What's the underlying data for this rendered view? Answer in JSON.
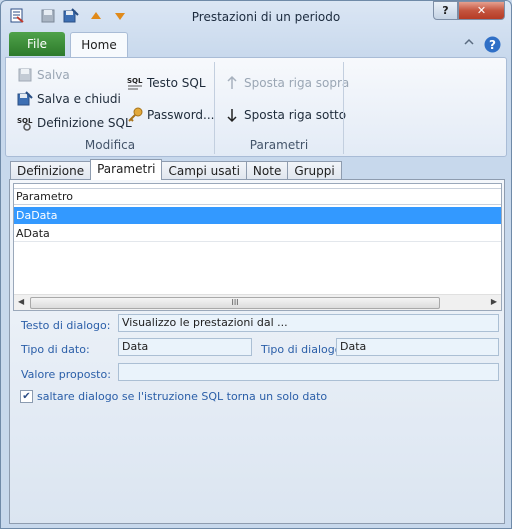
{
  "window": {
    "title": "Prestazioni di un periodo",
    "help_glyph": "?",
    "close_glyph": "✕"
  },
  "ribbon": {
    "tabs": {
      "file": "File",
      "home": "Home"
    },
    "modifica": {
      "salva": "Salva",
      "salva_chiudi": "Salva e chiudi",
      "definizione_sql": "Definizione SQL",
      "testo_sql": "Testo SQL",
      "password": "Password...",
      "label": "Modifica"
    },
    "parametri": {
      "sposta_sopra": "Sposta riga sopra",
      "sposta_sotto": "Sposta riga sotto",
      "label": "Parametri"
    }
  },
  "tabs": [
    "Definizione",
    "Parametri",
    "Campi usati",
    "Note",
    "Gruppi"
  ],
  "grid": {
    "header": "Parametro",
    "rows": [
      "DaData",
      "AData"
    ],
    "scroll_glyph": "III"
  },
  "form": {
    "testo_dialogo_label": "Testo di dialogo:",
    "testo_dialogo_value": "Visualizzo le prestazioni dal ...",
    "tipo_dato_label": "Tipo di dato:",
    "tipo_dato_value": "Data",
    "tipo_dialogo_label": "Tipo di dialogo:",
    "tipo_dialogo_value": "Data",
    "valore_proposto_label": "Valore proposto:",
    "valore_proposto_value": "",
    "checkbox_label": "saltare dialogo se l'istruzione SQL torna un solo dato",
    "checkbox_checked": true
  },
  "colors": {
    "accent": "#3399ff",
    "file_tab": "#2d7a2b",
    "label_blue": "#2a5ea8"
  }
}
